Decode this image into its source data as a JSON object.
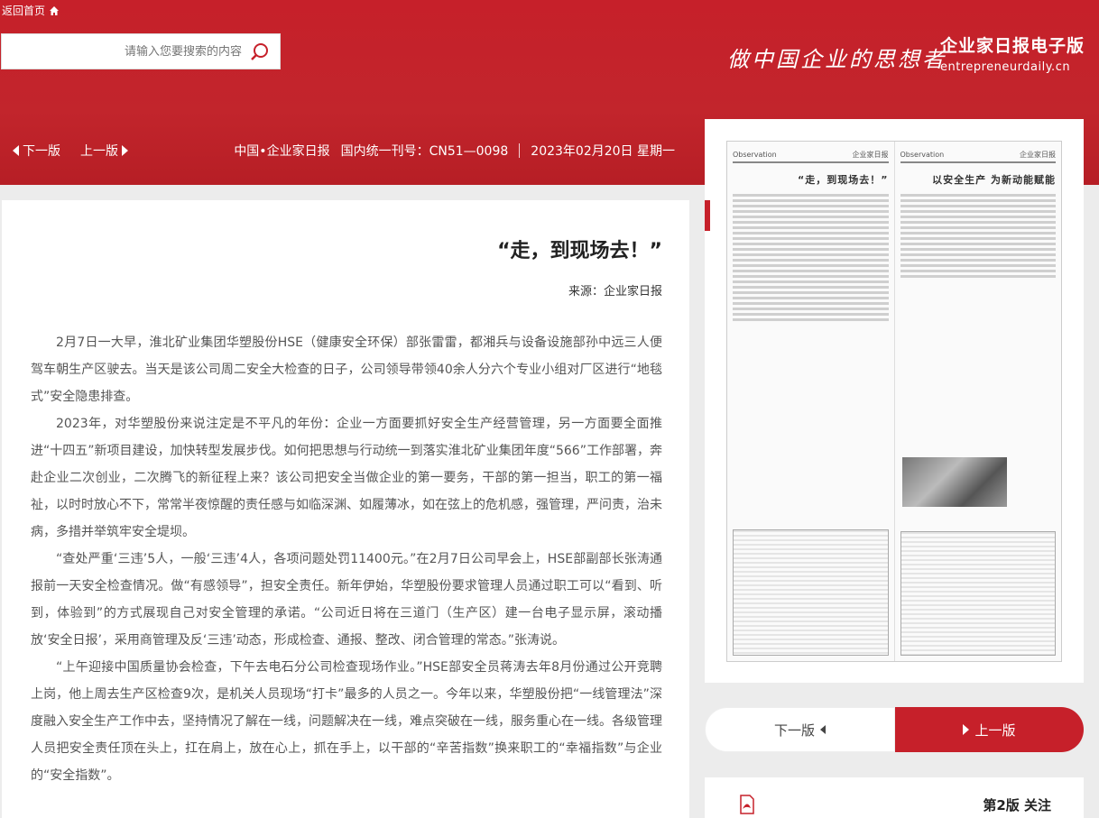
{
  "topbar": {
    "home_label": "返回首页"
  },
  "search": {
    "placeholder": "请输入您要搜索的内容"
  },
  "brand": {
    "title": "企业家日报电子版",
    "url": "entrepreneurdaily.cn",
    "slogan": "做中国企业的思想者"
  },
  "issue": {
    "date": "2023年02月20日 星期一",
    "cn_number": "国内统一刊号：CN51—0098",
    "paper_name": "中国•企业家日报"
  },
  "nav": {
    "prev_label": "上一版",
    "next_label": "下一版"
  },
  "article": {
    "title": "“走，到现场去！”",
    "source": "来源：企业家日报",
    "paragraphs": [
      "2月7日一大早，淮北矿业集团华塑股份HSE（健康安全环保）部张雷雷，都湘兵与设备设施部孙中远三人便驾车朝生产区驶去。当天是该公司周二安全大检查的日子，公司领导带领40余人分六个专业小组对厂区进行“地毯式”安全隐患排查。",
      "2023年，对华塑股份来说注定是不平凡的年份：企业一方面要抓好安全生产经营管理，另一方面要全面推进“十四五”新项目建设，加快转型发展步伐。如何把思想与行动统一到落实淮北矿业集团年度“566”工作部署，奔赴企业二次创业，二次腾飞的新征程上来？该公司把安全当做企业的第一要务，干部的第一担当，职工的第一福祉，以时时放心不下，常常半夜惊醒的责任感与如临深渊、如履薄冰，如在弦上的危机感，强管理，严问责，治未病，多措并举筑牢安全堤坝。",
      "“查处严重‘三违’5人，一般‘三违’4人，各项问题处罚11400元。”在2月7日公司早会上，HSE部副部长张涛通报前一天安全检查情况。做“有感领导”，担安全责任。新年伊始，华塑股份要求管理人员通过职工可以“看到、听到，体验到”的方式展现自己对安全管理的承诺。“公司近日将在三道门（生产区）建一台电子显示屏，滚动播放‘安全日报’，采用商管理及反‘三违’动态，形成检查、通报、整改、闭合管理的常态。”张涛说。",
      "“上午迎接中国质量协会检查，下午去电石分公司检查现场作业。”HSE部安全员蒋涛去年8月份通过公开竞聘上岗，他上周去生产区检查9次，是机关人员现场“打卡”最多的人员之一。今年以来，华塑股份把“一线管理法”深度融入安全生产工作中去，坚持情况了解在一线，问题解决在一线，难点突破在一线，服务重心在一线。各级管理人员把安全责任顶在头上，扛在肩上，放在心上，抓在手上，以干部的“辛苦指数”换来职工的“幸福指数”与企业的“安全指数”。"
    ]
  },
  "thumbnail": {
    "left_page_masthead": "企业家日报",
    "left_page_tag": "Observation",
    "left_headline": "“走，到现场去！”",
    "right_page_masthead": "企业家日报",
    "right_page_tag": "Observation",
    "right_headline": "以安全生产 为新动能赋能"
  },
  "section": {
    "title": "第2版 关注"
  },
  "colors": {
    "brand_red": "#c6202a",
    "panel_bg": "#ececec"
  }
}
